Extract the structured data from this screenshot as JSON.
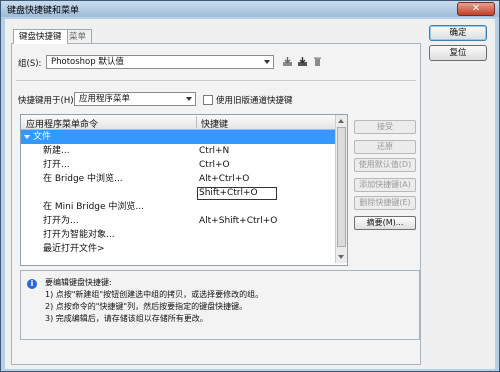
{
  "window": {
    "title": "键盘快捷键和菜单"
  },
  "tabs": [
    {
      "label": "键盘快捷键"
    },
    {
      "label": "菜单"
    }
  ],
  "set": {
    "label": "组(S):",
    "value": "Photoshop 默认值"
  },
  "shortcuts_for": {
    "label": "快捷键用于(H):",
    "value": "应用程序菜单"
  },
  "legacy": {
    "label": "使用旧版通道快捷键",
    "checked": false
  },
  "table": {
    "col_command": "应用程序菜单命令",
    "col_shortcut": "快捷键",
    "rows": [
      {
        "cmd": "文件",
        "key": ""
      },
      {
        "cmd": "新建...",
        "key": "Ctrl+N"
      },
      {
        "cmd": "打开...",
        "key": "Ctrl+O"
      },
      {
        "cmd": "在 Bridge 中浏览...",
        "key": "Alt+Ctrl+O"
      },
      {
        "cmd": "",
        "key": "Shift+Ctrl+O"
      },
      {
        "cmd": "在 Mini Bridge 中浏览...",
        "key": ""
      },
      {
        "cmd": "打开为...",
        "key": "Alt+Shift+Ctrl+O"
      },
      {
        "cmd": "打开为智能对象...",
        "key": ""
      },
      {
        "cmd": "最近打开文件>",
        "key": ""
      }
    ]
  },
  "side_buttons": {
    "accept": "接受",
    "undo": "还原",
    "use_default": "使用默认值(D)",
    "add": "添加快捷键(A)",
    "delete": "删除快捷键(E)",
    "summarize": "摘要(M)..."
  },
  "info": {
    "lines": [
      "要编辑键盘快捷键:",
      "1) 点按\"新建组\"按钮创建选中组的拷贝，或选择要修改的组。",
      "2) 点按命令的\"快捷键\"列，然后按要指定的键盘快捷键。",
      "3) 完成编辑后，请存储该组以存储所有更改。"
    ]
  },
  "dialog_buttons": {
    "ok": "确定",
    "reset": "复位"
  }
}
